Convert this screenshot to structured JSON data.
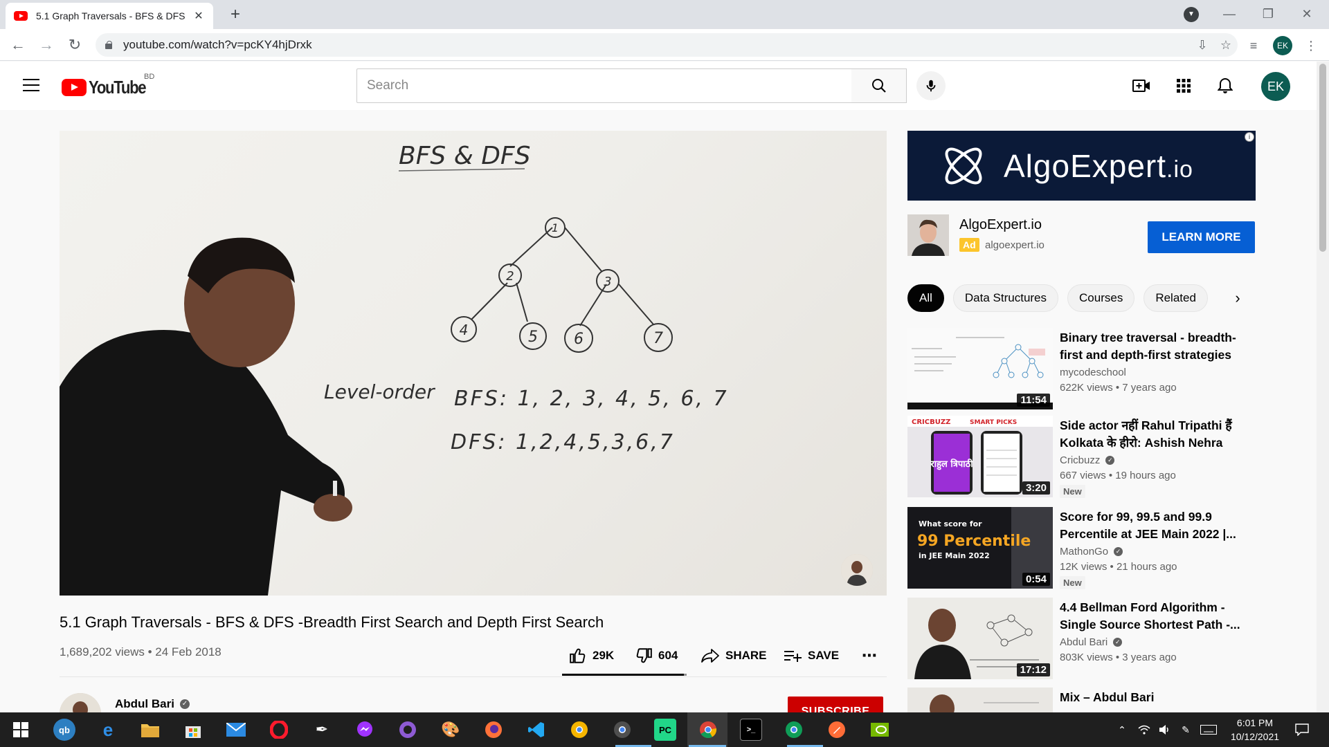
{
  "browser": {
    "tab_title": "5.1 Graph Traversals - BFS & DFS",
    "url": "youtube.com/watch?v=pcKY4hjDrxk",
    "profile_initials": "EK"
  },
  "header": {
    "logo_text": "YouTube",
    "region": "BD",
    "search_placeholder": "Search",
    "avatar_initials": "EK"
  },
  "video": {
    "board_title": "BFS & DFS",
    "tree_nodes": [
      "1",
      "2",
      "3",
      "4",
      "5",
      "6",
      "7"
    ],
    "board_label": "Level-order",
    "board_bfs": "BFS: 1, 2, 3, 4, 5, 6, 7",
    "board_dfs": "DFS: 1,2,4,5,3,6,7",
    "title": "5.1 Graph Traversals - BFS & DFS -Breadth First Search and Depth First Search",
    "views": "1,689,202 views",
    "date": "24 Feb 2018",
    "likes": "29K",
    "dislikes": "604",
    "like_ratio": 0.98,
    "share_label": "SHARE",
    "save_label": "SAVE",
    "more_label": "⋯",
    "channel": "Abdul Bari",
    "subscribe_label": "SUBSCRIBE"
  },
  "ad": {
    "banner_brand": "AlgoExpert",
    "banner_tld": ".io",
    "name": "AlgoExpert.io",
    "badge": "Ad",
    "domain": "algoexpert.io",
    "cta": "LEARN MORE",
    "info_icon": "i"
  },
  "chips": [
    "All",
    "Data Structures",
    "Courses",
    "Related"
  ],
  "recommendations": [
    {
      "title": "Binary tree traversal - breadth-first and depth-first strategies",
      "channel": "mycodeschool",
      "verified": false,
      "stats": "622K views • 7 years ago",
      "duration": "11:54",
      "badge": ""
    },
    {
      "title": "Side actor नहीं Rahul Tripathi हैं Kolkata के हीरो: Ashish Nehra",
      "channel": "Cricbuzz",
      "verified": true,
      "stats": "667 views • 19 hours ago",
      "duration": "3:20",
      "badge": "New",
      "thumb_brand": "CRICBUZZ",
      "thumb_caption": "SMART PICKS",
      "thumb_name": "राहुल त्रिपाठी"
    },
    {
      "title": "Score for 99, 99.5 and 99.9 Percentile at JEE Main 2022 |...",
      "channel": "MathonGo",
      "verified": true,
      "stats": "12K views • 21 hours ago",
      "duration": "0:54",
      "badge": "New",
      "thumb_line1": "What score for",
      "thumb_line2": "99 Percentile",
      "thumb_line3": "in JEE Main 2022"
    },
    {
      "title": "4.4 Bellman Ford Algorithm - Single Source Shortest Path -...",
      "channel": "Abdul Bari",
      "verified": true,
      "stats": "803K views • 3 years ago",
      "duration": "17:12",
      "badge": ""
    },
    {
      "title": "Mix – Abdul Bari",
      "channel": "",
      "verified": false,
      "stats": "",
      "duration": "",
      "badge": ""
    }
  ],
  "taskbar": {
    "time": "6:01 PM",
    "date": "10/12/2021",
    "apps": [
      "start",
      "qb",
      "edge",
      "file-explorer",
      "store",
      "mail",
      "opera",
      "inkscape",
      "messenger",
      "github",
      "paint",
      "firefox",
      "vscode",
      "chrome-canary",
      "chrome-dev",
      "pycharm",
      "chrome",
      "terminal",
      "chrome-profile",
      "postman",
      "nvidia"
    ]
  }
}
